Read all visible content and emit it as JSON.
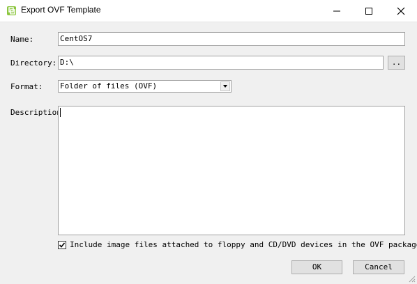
{
  "window": {
    "title": "Export OVF Template",
    "icon": "vmware-workstation-icon",
    "controls": [
      "minimize-icon",
      "maximize-icon",
      "close-icon"
    ]
  },
  "form": {
    "name_label": "Name:",
    "name_value": "CentOS7",
    "directory_label": "Directory:",
    "directory_value": "D:\\",
    "browse_label": "..",
    "format_label": "Format:",
    "format_value": "Folder of files (OVF)",
    "description_label": "Description",
    "description_value": "",
    "include_images_label": "Include image files attached to floppy and CD/DVD devices in the OVF package",
    "include_images_checked": true
  },
  "buttons": {
    "ok": "OK",
    "cancel": "Cancel"
  }
}
